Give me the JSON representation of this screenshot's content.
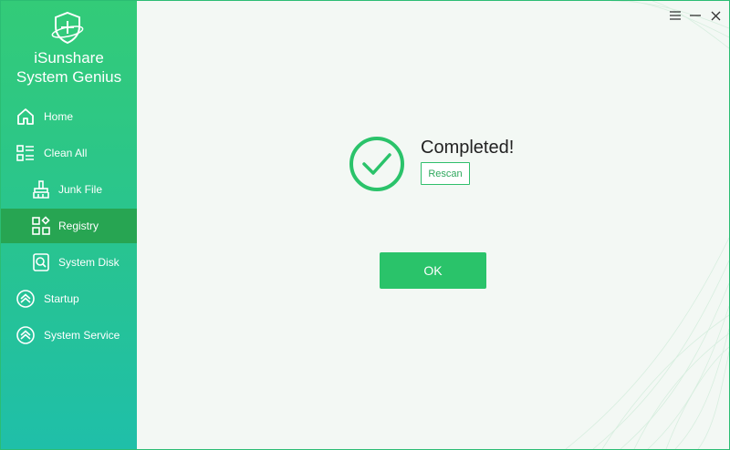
{
  "app": {
    "name_line1": "iSunshare",
    "name_line2": "System Genius",
    "logo_icon": "shield-plus-icon"
  },
  "sidebar": {
    "items": [
      {
        "label": "Home",
        "icon": "home-icon",
        "active": false
      },
      {
        "label": "Clean All",
        "icon": "list-icon",
        "active": false
      },
      {
        "label": "Junk File",
        "icon": "brush-icon",
        "active": false
      },
      {
        "label": "Registry",
        "icon": "registry-grid-icon",
        "active": true
      },
      {
        "label": "System Disk",
        "icon": "disk-search-icon",
        "active": false
      },
      {
        "label": "Startup",
        "icon": "chevron-up-circle-icon",
        "active": false
      },
      {
        "label": "System Service",
        "icon": "chevron-up-circle-icon",
        "active": false
      }
    ]
  },
  "window_controls": {
    "menu_icon": "menu-icon",
    "minimize_icon": "minimize-icon",
    "close_icon": "close-icon"
  },
  "main": {
    "status_text": "Completed!",
    "rescan_label": "Rescan",
    "ok_label": "OK",
    "status_icon": "check-circle-icon"
  },
  "colors": {
    "accent": "#2ac36a",
    "sidebar_active": "#27a552",
    "background": "#f3f8f4"
  }
}
